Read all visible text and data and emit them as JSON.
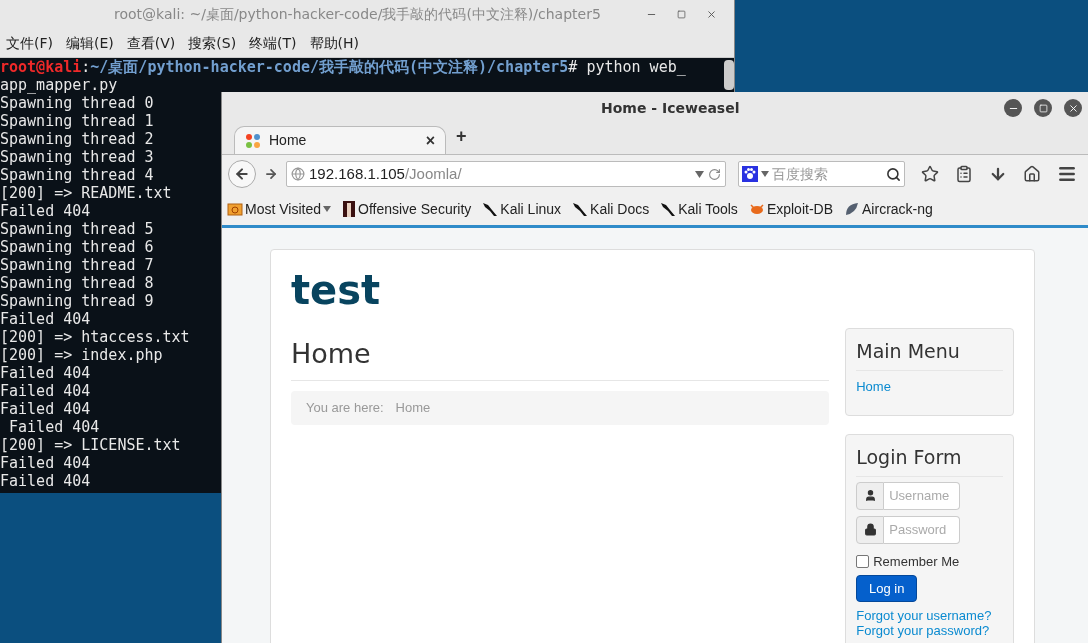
{
  "terminal": {
    "title": "root@kali: ~/桌面/python-hacker-code/我手敲的代码(中文注释)/chapter5",
    "menu": [
      "文件(F)",
      "编辑(E)",
      "查看(V)",
      "搜索(S)",
      "终端(T)",
      "帮助(H)"
    ],
    "prompt": {
      "user": "root@kali",
      "separator": ":",
      "path": "~/桌面/python-hacker-code/我手敲的代码(中文注释)/chapter5",
      "command": "# python web_app_mapper.py"
    },
    "lines": [
      "Spawning thread 0",
      "Spawning thread 1",
      "Spawning thread 2",
      "Spawning thread 3",
      "Spawning thread 4",
      "[200] => README.txt",
      "Failed 404",
      "Spawning thread 5",
      "Spawning thread 6",
      "Spawning thread 7",
      "Spawning thread 8",
      "Spawning thread 9",
      "Failed 404",
      "[200] => htaccess.txt",
      "[200] => index.php",
      "Failed 404",
      "Failed 404",
      "Failed 404",
      " Failed 404",
      "[200] => LICENSE.txt",
      "Failed 404",
      "Failed 404"
    ]
  },
  "browser": {
    "title": "Home - Iceweasel",
    "tabs": [
      {
        "label": "Home",
        "selected": true,
        "close": "×"
      }
    ],
    "new_tab": "+",
    "url": {
      "host": "192.168.1.105",
      "path": "/Joomla/"
    },
    "search": {
      "placeholder": "百度搜索"
    },
    "bookmarks": [
      {
        "kind": "folder",
        "label": "Most Visited"
      },
      {
        "kind": "offsec",
        "label": "Offensive Security"
      },
      {
        "kind": "kali",
        "label": "Kali Linux"
      },
      {
        "kind": "kali",
        "label": "Kali Docs"
      },
      {
        "kind": "kali",
        "label": "Kali Tools"
      },
      {
        "kind": "exploit",
        "label": "Exploit-DB"
      },
      {
        "kind": "aircrack",
        "label": "Aircrack-ng"
      }
    ]
  },
  "page": {
    "site_title": "test",
    "heading": "Home",
    "breadcrumb": {
      "label": "You are here:",
      "items": [
        "Home"
      ]
    },
    "main_menu": {
      "title": "Main Menu",
      "items": [
        "Home"
      ]
    },
    "login": {
      "title": "Login Form",
      "username": {
        "placeholder": "Username"
      },
      "password": {
        "placeholder": "Password"
      },
      "remember": {
        "label": "Remember Me",
        "checked": false
      },
      "button": "Log in",
      "links": [
        "Forgot your username?",
        "Forgot your password?"
      ]
    }
  }
}
